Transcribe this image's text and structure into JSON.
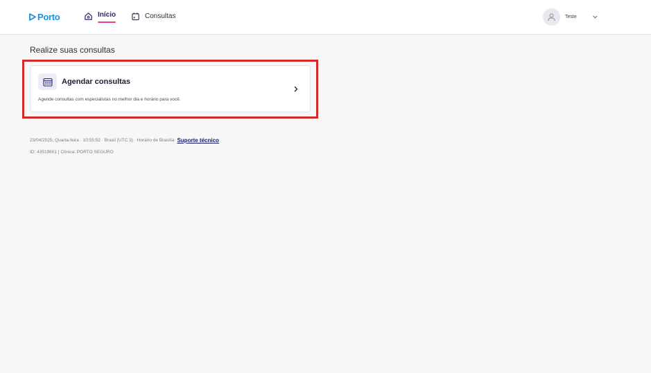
{
  "header": {
    "logo_text": "Porto",
    "nav": [
      {
        "label": "Início",
        "active": true,
        "icon": "home-icon"
      },
      {
        "label": "Consultas",
        "active": false,
        "icon": "calendar-icon"
      }
    ],
    "user": {
      "name": "Teste",
      "icon": "user-icon"
    }
  },
  "main": {
    "title": "Realize suas consultas",
    "card": {
      "title": "Agendar consultas",
      "description": "Agende consultas com especialistas no melhor dia e horário para você.",
      "icon": "calendar-grid-icon"
    }
  },
  "footer": {
    "datetime": "23/04/2025, Quarta-feira · 10:55:52 · Brasil (UTC 3) · Horário de Brasília",
    "support_link": "Suporte técnico",
    "id_line": "ID: 43519601 | Clínica: PORTO SEGURO"
  },
  "colors": {
    "brand": "#1a8fe3",
    "accent": "#e23f8e",
    "highlight": "#d42a2a"
  }
}
